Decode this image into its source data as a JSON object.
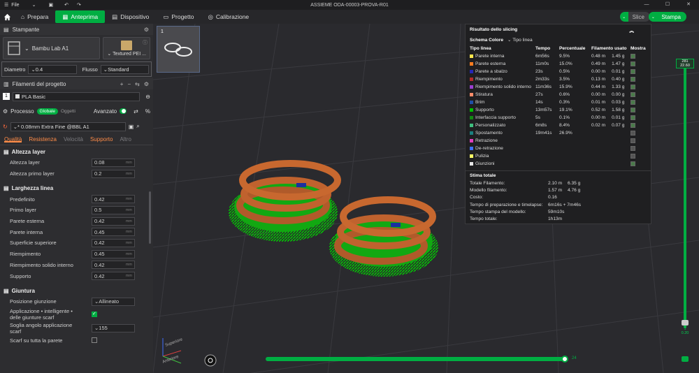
{
  "window": {
    "menu_label": "File",
    "title": "ASSIEME ODA-00003-PROVA-R01"
  },
  "navbar": {
    "tabs": [
      {
        "label": "Prepara"
      },
      {
        "label": "Anteprima"
      },
      {
        "label": "Dispositivo"
      },
      {
        "label": "Progetto"
      },
      {
        "label": "Calibrazione"
      }
    ],
    "slice_label": "Slice",
    "print_label": "Stampa"
  },
  "sidebar": {
    "printer_header": "Stampante",
    "printer_name": "Bambu Lab A1",
    "plate_name": "Textured PEI ...",
    "diameter_label": "Diametro",
    "diameter_value": "0.4",
    "flow_label": "Flusso",
    "flow_value": "Standard",
    "filaments_header": "Filamenti del progetto",
    "filament_index": "1",
    "filament_name": "PLA Basic",
    "process_label": "Processo",
    "process_global": "Globale",
    "process_objects": "Oggetti",
    "advanced_label": "Avanzato",
    "preset_name": "* 0.08mm Extra Fine @BBL A1",
    "subtabs": [
      "Qualità",
      "Resistenza",
      "Velocità",
      "Supporto",
      "Altro"
    ],
    "groups": [
      {
        "title": "Altezza layer",
        "params": [
          {
            "label": "Altezza layer",
            "value": "0.08",
            "unit": "mm"
          },
          {
            "label": "Altezza primo layer",
            "value": "0.2",
            "unit": "mm"
          }
        ]
      },
      {
        "title": "Larghezza linea",
        "params": [
          {
            "label": "Predefinito",
            "value": "0.42",
            "unit": "mm"
          },
          {
            "label": "Primo layer",
            "value": "0.5",
            "unit": "mm"
          },
          {
            "label": "Parete esterna",
            "value": "0.42",
            "unit": "mm"
          },
          {
            "label": "Parete interna",
            "value": "0.45",
            "unit": "mm"
          },
          {
            "label": "Superficie superiore",
            "value": "0.42",
            "unit": "mm"
          },
          {
            "label": "Riempimento",
            "value": "0.45",
            "unit": "mm"
          },
          {
            "label": "Riempimento solido interno",
            "value": "0.42",
            "unit": "mm"
          },
          {
            "label": "Supporto",
            "value": "0.42",
            "unit": "mm"
          }
        ]
      }
    ],
    "seam_group": "Giuntura",
    "seam_position_label": "Posizione giunzione",
    "seam_position_value": "Allineato",
    "scarf_label_1": "Applicazione • intelligente •",
    "scarf_label_2": "delle giunture scarf",
    "scarf_angle_label_1": "Soglia angolo applicazione",
    "scarf_angle_label_2": "scarf",
    "scarf_angle_value": "155",
    "scarf_whole_label": "Scarf su tutta la parete"
  },
  "plate_thumb": {
    "number": "1"
  },
  "slicing": {
    "title": "Risultato dello slicing",
    "scheme_label": "Schema Colore",
    "scheme_value": "Tipo linea",
    "headers": [
      "Tipo linea",
      "Tempo",
      "Percentuale",
      "Filamento usato",
      "Mostra"
    ],
    "rows": [
      {
        "name": "Parete interna",
        "color": "#ffe64d",
        "time": "6m56s",
        "pct": "9.5%",
        "len": "0.48 m",
        "wt": "1.45 g",
        "show": true
      },
      {
        "name": "Parete esterna",
        "color": "#ff7c1f",
        "time": "11m0s",
        "pct": "15.0%",
        "len": "0.49 m",
        "wt": "1.47 g",
        "show": true
      },
      {
        "name": "Parete a sbalzo",
        "color": "#2626b8",
        "time": "23s",
        "pct": "0.5%",
        "len": "0.00 m",
        "wt": "0.01 g",
        "show": true
      },
      {
        "name": "Riempimento",
        "color": "#b52a2a",
        "time": "2m33s",
        "pct": "3.5%",
        "len": "0.13 m",
        "wt": "0.40 g",
        "show": true
      },
      {
        "name": "Riempimento solido interno",
        "color": "#9b3fd1",
        "time": "11m36s",
        "pct": "15.9%",
        "len": "0.44 m",
        "wt": "1.33 g",
        "show": true
      },
      {
        "name": "Stiratura",
        "color": "#ff8c69",
        "time": "27s",
        "pct": "0.6%",
        "len": "0.00 m",
        "wt": "0.00 g",
        "show": true
      },
      {
        "name": "Brim",
        "color": "#1f4fa8",
        "time": "14s",
        "pct": "0.3%",
        "len": "0.01 m",
        "wt": "0.03 g",
        "show": true
      },
      {
        "name": "Supporto",
        "color": "#00c000",
        "time": "13m57s",
        "pct": "19.1%",
        "len": "0.52 m",
        "wt": "1.58 g",
        "show": true
      },
      {
        "name": "Interfaccia supporto",
        "color": "#128a12",
        "time": "5s",
        "pct": "0.1%",
        "len": "0.00 m",
        "wt": "0.01 g",
        "show": true
      },
      {
        "name": "Personalizzato",
        "color": "#3fbf7f",
        "time": "6m8s",
        "pct": "8.4%",
        "len": "0.02 m",
        "wt": "0.07 g",
        "show": true
      },
      {
        "name": "Spostamento",
        "color": "#1a7f7f",
        "time": "19m41s",
        "pct": "26.9%",
        "len": "",
        "wt": "",
        "show": false
      },
      {
        "name": "Retrazione",
        "color": "#e03fbf",
        "time": "",
        "pct": "",
        "len": "",
        "wt": "",
        "show": false
      },
      {
        "name": "De-retrazione",
        "color": "#3f6fff",
        "time": "",
        "pct": "",
        "len": "",
        "wt": "",
        "show": false
      },
      {
        "name": "Pulizia",
        "color": "#ffff66",
        "time": "",
        "pct": "",
        "len": "",
        "wt": "",
        "show": false
      },
      {
        "name": "Giunzioni",
        "color": "#e6e6e6",
        "time": "",
        "pct": "",
        "len": "",
        "wt": "",
        "show": true
      }
    ],
    "estimate_title": "Stima totale",
    "estimate": [
      {
        "k": "Totale Filamento:",
        "v1": "2.10 m",
        "v2": "6.35 g"
      },
      {
        "k": "Modello filamento:",
        "v1": "1.57 m",
        "v2": "4.76 g"
      },
      {
        "k": "Costo:",
        "v1": "0.16",
        "v2": ""
      },
      {
        "k": "Tempo di preparazione e timelapse:",
        "v1": "6m16s + 7m46s",
        "v2": ""
      },
      {
        "k": "Tempo stampa del modello:",
        "v1": "59m10s",
        "v2": ""
      },
      {
        "k": "Tempo totale:",
        "v1": "1h13m",
        "v2": ""
      }
    ]
  },
  "layer_slider": {
    "top_layer": "281",
    "top_height": "22.60",
    "bottom_layer": "1",
    "bottom_height": "0.20",
    "move_label": "24"
  },
  "axis": {
    "top": "Superiore",
    "left": "Anteriore"
  }
}
